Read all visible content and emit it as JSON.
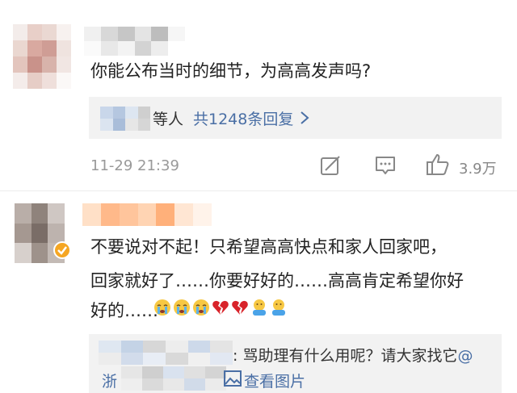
{
  "comment1": {
    "text": "你能公布当时的细节，为高高发声吗?",
    "replies": {
      "etc": "等人",
      "count_link": "共1248条回复"
    },
    "time": "11-29 21:39",
    "like_count": "3.9万"
  },
  "comment2": {
    "lines": [
      "不要说对不起！只希望高高快点和家人回家吧，",
      "回家就好了……你要好好的……高高肯定希望你好",
      "好的……"
    ],
    "emojis": [
      "crying-face",
      "crying-face",
      "crying-face",
      "broken-heart",
      "broken-heart",
      "hugging-face",
      "hugging-face"
    ],
    "quote": {
      "text": ": 骂助理有什么用呢？请大家找它",
      "at": "@",
      "location": "浙",
      "view_image": "查看图片"
    }
  },
  "colors": {
    "link": "#4a6fa5",
    "muted": "#999999",
    "panel": "#f2f2f2",
    "badge": "#f5a623"
  }
}
